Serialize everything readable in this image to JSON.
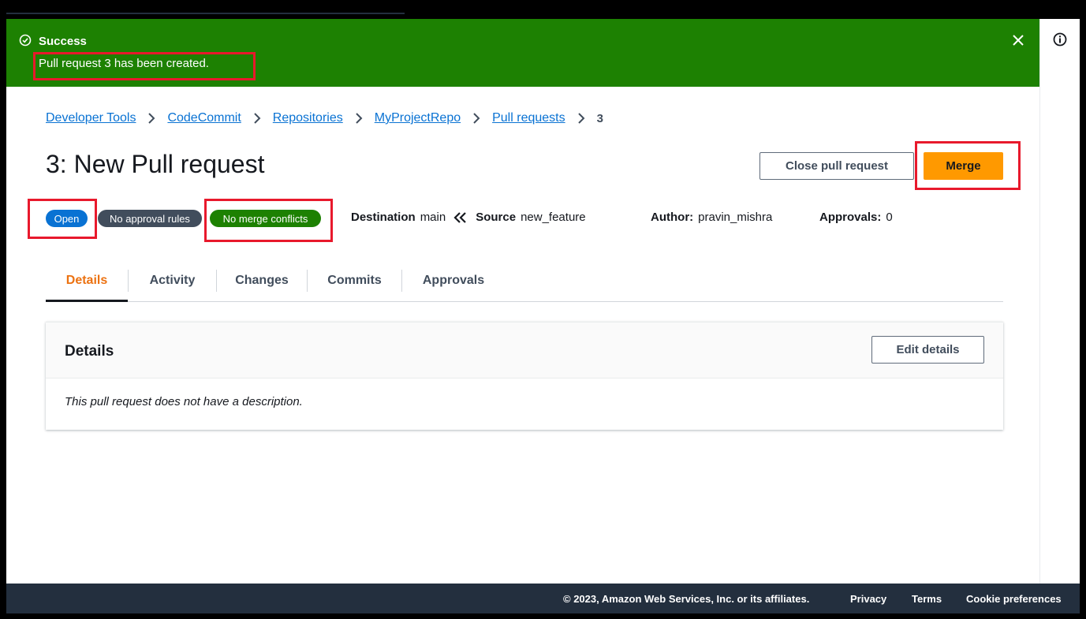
{
  "flash": {
    "title": "Success",
    "message": "Pull request 3 has been created.",
    "color": "#1d8102"
  },
  "breadcrumb": [
    {
      "label": "Developer Tools"
    },
    {
      "label": "CodeCommit"
    },
    {
      "label": "Repositories"
    },
    {
      "label": "MyProjectRepo"
    },
    {
      "label": "Pull requests"
    },
    {
      "label": "3"
    }
  ],
  "page": {
    "title": "3: New Pull request"
  },
  "actions": {
    "close_pr_label": "Close pull request",
    "merge_label": "Merge",
    "merge_color": "#ff9900"
  },
  "badges": {
    "status": "Open",
    "approval_rules": "No approval rules",
    "merge": "No merge conflicts"
  },
  "meta": {
    "destination_label": "Destination",
    "destination_value": "main",
    "source_label": "Source",
    "source_value": "new_feature",
    "author_label": "Author:",
    "author_value": "pravin_mishra",
    "approvals_label": "Approvals:",
    "approvals_value": "0"
  },
  "tabs": [
    {
      "label": "Details",
      "active": true
    },
    {
      "label": "Activity"
    },
    {
      "label": "Changes"
    },
    {
      "label": "Commits"
    },
    {
      "label": "Approvals"
    }
  ],
  "details_panel": {
    "title": "Details",
    "edit_label": "Edit details",
    "description": "This pull request does not have a description."
  },
  "footer": {
    "copyright": "© 2023, Amazon Web Services, Inc. or its affiliates.",
    "privacy": "Privacy",
    "terms": "Terms",
    "cookie": "Cookie preferences"
  },
  "icons": {
    "success": "check-circle-icon",
    "close": "close-icon",
    "info": "info-icon",
    "breadcrumb_separator": "chevron-right-icon",
    "direction": "double-chevron-left-icon"
  }
}
